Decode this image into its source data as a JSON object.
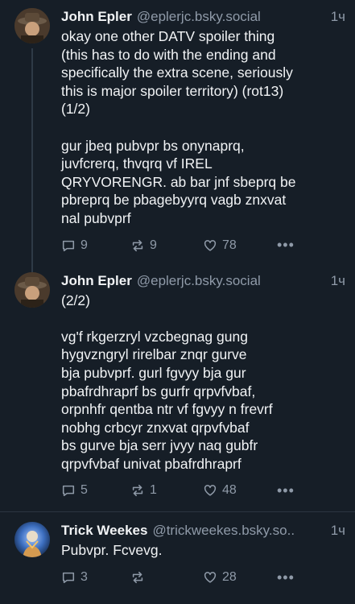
{
  "posts": [
    {
      "author_name": "John Epler",
      "author_handle": "@eplerjc.bsky.social",
      "time": "1ч",
      "text": "okay one other DATV spoiler thing\n(this has to do with the ending and\nspecifically the extra scene, seriously\nthis is major spoiler territory) (rot13)\n(1/2)\n\ngur jbeq pubvpr bs onynaprq,\njuvfcrerq, thvqrq vf IREL\nQRYVORENGR. ab bar jnf sbeprq be\npbreprq be pbagebyyrq vagb znxvat\nnal pubvprf",
      "replies": "9",
      "reposts": "9",
      "likes": "78"
    },
    {
      "author_name": "John Epler",
      "author_handle": "@eplerjc.bsky.social",
      "time": "1ч",
      "text": "(2/2)\n\nvg'f rkgerzryl vzcbegnag gung\nhygvzngryl rirelbar znqr gurve\nbja pubvprf. gurl fgvyy bja gur\npbafrdhraprf bs gurfr qrpvfvbaf,\norpnhfr qentba ntr vf fgvyy n frevrf\nnobhg crbcyr znxvat qrpvfvbaf\nbs gurve bja serr jvyy naq gubfr\nqrpvfvbaf univat pbafrdhraprf",
      "replies": "5",
      "reposts": "1",
      "likes": "48"
    },
    {
      "author_name": "Trick Weekes",
      "author_handle": "@trickweekes.bsky.so..",
      "time": "1ч",
      "text": "Pubvpr. Fcvevg.",
      "replies": "3",
      "reposts": "",
      "likes": "28"
    }
  ],
  "icons": {
    "reply": "speech-bubble-icon",
    "repost": "repost-arrows-icon",
    "like": "heart-icon",
    "more": "ellipsis-icon"
  },
  "colors": {
    "background": "#161e27",
    "text": "#f1f3f5",
    "muted": "#8f9aa8",
    "divider": "#2b3540"
  }
}
